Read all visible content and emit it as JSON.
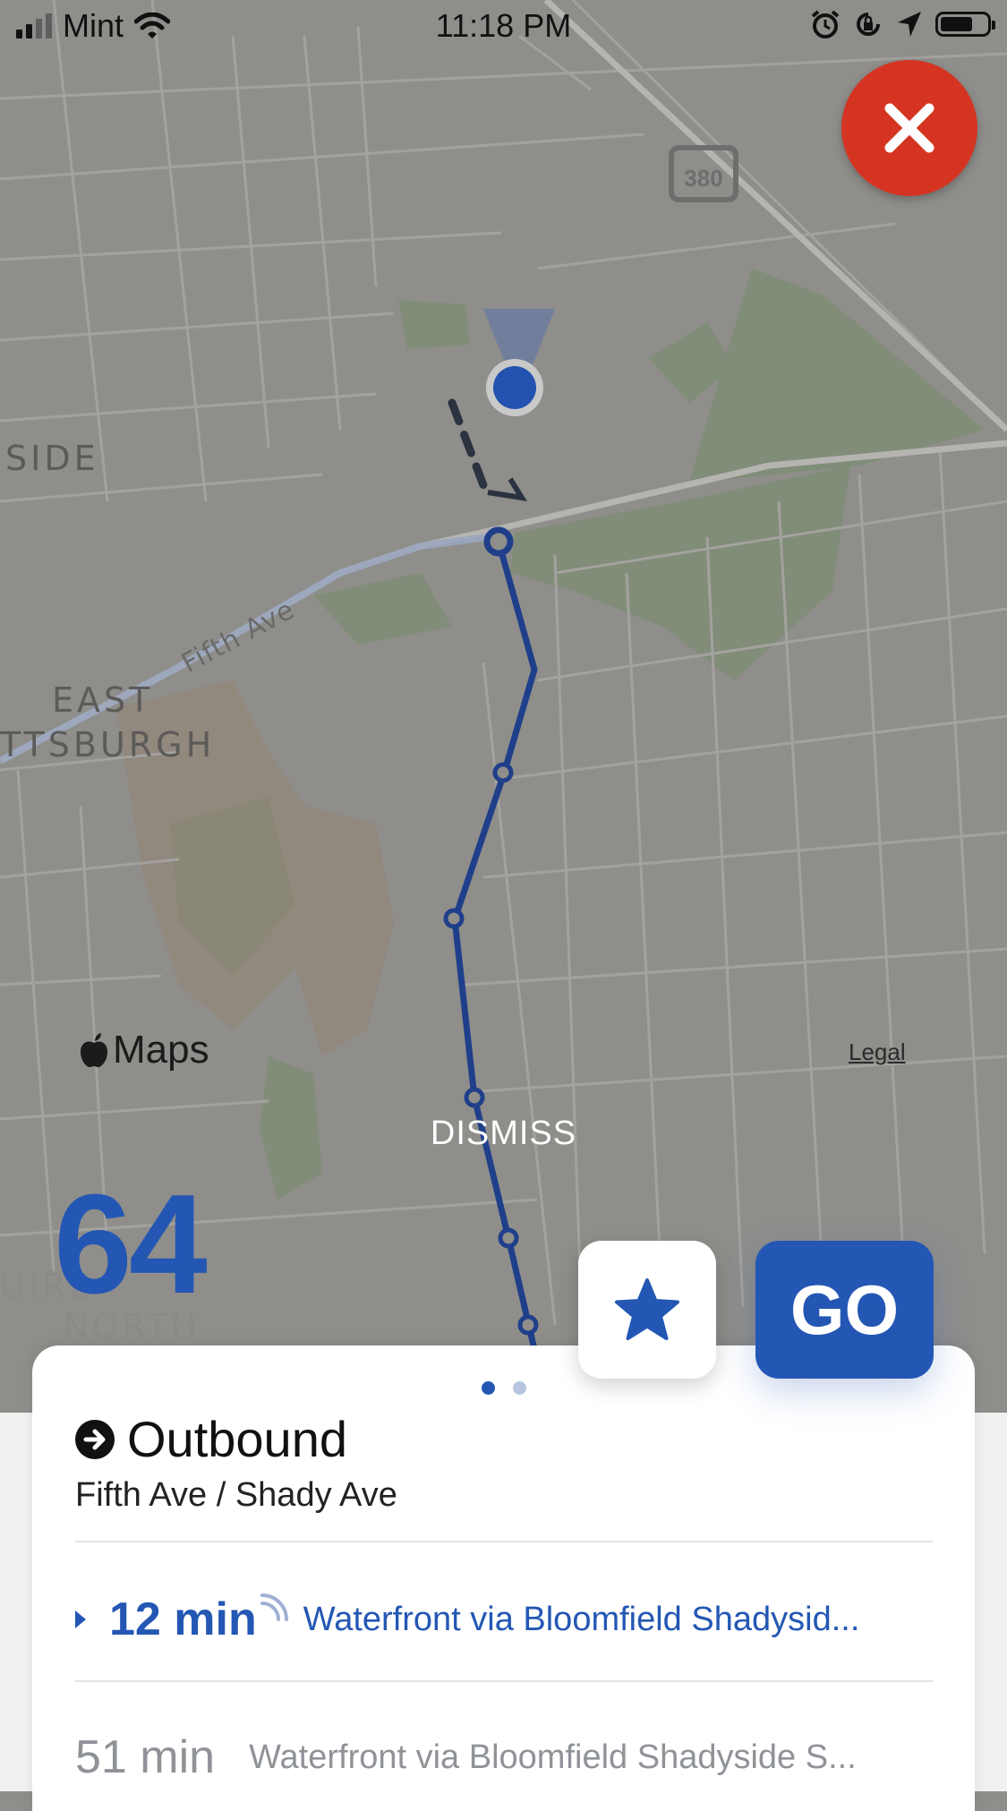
{
  "status_bar": {
    "carrier": "Mint",
    "time": "11:18 PM",
    "battery_level": 0.7
  },
  "map": {
    "labels": {
      "side": "SIDE",
      "east": "EAST",
      "pittsburgh": "TTSBURGH",
      "fifth_ave": "Fifth Ave",
      "shield": "380",
      "bottom_left_1": "UIRE",
      "bottom_left_2": "NORTH"
    },
    "maps_logo": "Maps",
    "legal": "Legal",
    "route_color": "#1f3f8a",
    "user_location_color": "#2352b0"
  },
  "overlay": {
    "dismiss": "DISMISS",
    "route_number": "64",
    "go_label": "GO",
    "accent": "#2457b4",
    "close_color": "#d63422"
  },
  "sheet": {
    "page_count": 2,
    "current_page": 1,
    "direction": "Outbound",
    "stop": "Fifth Ave / Shady Ave",
    "arrivals": [
      {
        "time": "12 min",
        "destination": "Waterfront via Bloomfield Shadysid...",
        "realtime": true
      },
      {
        "time": "51 min",
        "destination": "Waterfront via Bloomfield Shadyside S...",
        "realtime": false
      }
    ]
  }
}
